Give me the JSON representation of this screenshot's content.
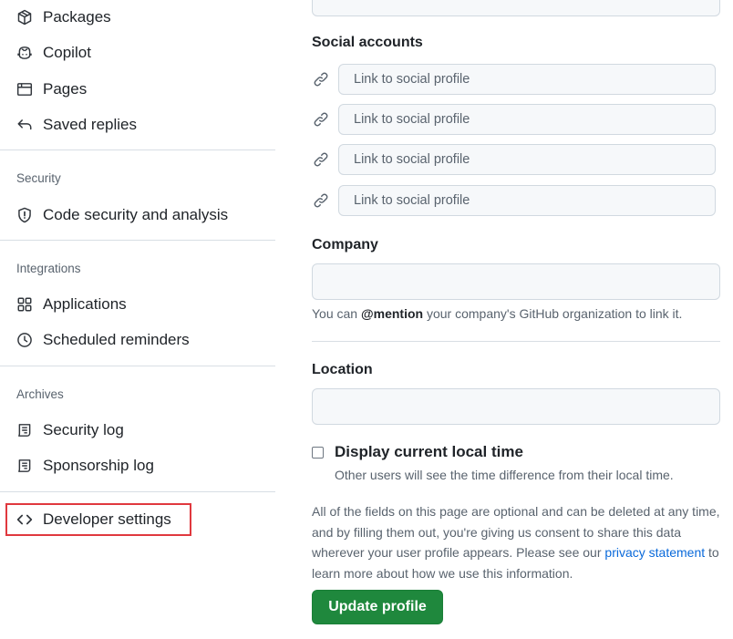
{
  "sidebar": {
    "items_top": [
      {
        "label": "Packages",
        "icon": "package-icon"
      },
      {
        "label": "Copilot",
        "icon": "copilot-icon"
      },
      {
        "label": "Pages",
        "icon": "browser-icon"
      },
      {
        "label": "Saved replies",
        "icon": "reply-icon"
      }
    ],
    "security": {
      "title": "Security",
      "items": [
        {
          "label": "Code security and analysis",
          "icon": "shield-icon"
        }
      ]
    },
    "integrations": {
      "title": "Integrations",
      "items": [
        {
          "label": "Applications",
          "icon": "apps-icon"
        },
        {
          "label": "Scheduled reminders",
          "icon": "clock-icon"
        }
      ]
    },
    "archives": {
      "title": "Archives",
      "items": [
        {
          "label": "Security log",
          "icon": "log-icon"
        },
        {
          "label": "Sponsorship log",
          "icon": "log-icon"
        }
      ]
    },
    "developer": {
      "label": "Developer settings",
      "icon": "code-icon"
    }
  },
  "main": {
    "social": {
      "heading": "Social accounts",
      "placeholders": [
        "Link to social profile",
        "Link to social profile",
        "Link to social profile",
        "Link to social profile"
      ]
    },
    "company": {
      "heading": "Company",
      "note_prefix": "You can ",
      "note_bold": "@mention",
      "note_suffix": " your company's GitHub organization to link it."
    },
    "location": {
      "heading": "Location"
    },
    "local_time": {
      "label": "Display current local time",
      "help": "Other users will see the time difference from their local time."
    },
    "privacy": {
      "text": "All of the fields on this page are optional and can be deleted at any time, and by filling them out, you're giving us consent to share this data wherever your user profile appears. Please see our ",
      "link": "privacy statement",
      "suffix": " to learn more about how we use this information."
    },
    "submit_label": "Update profile"
  },
  "colors": {
    "accent_button": "#1f883d",
    "link": "#0969da",
    "highlight_box": "#e0383e"
  }
}
